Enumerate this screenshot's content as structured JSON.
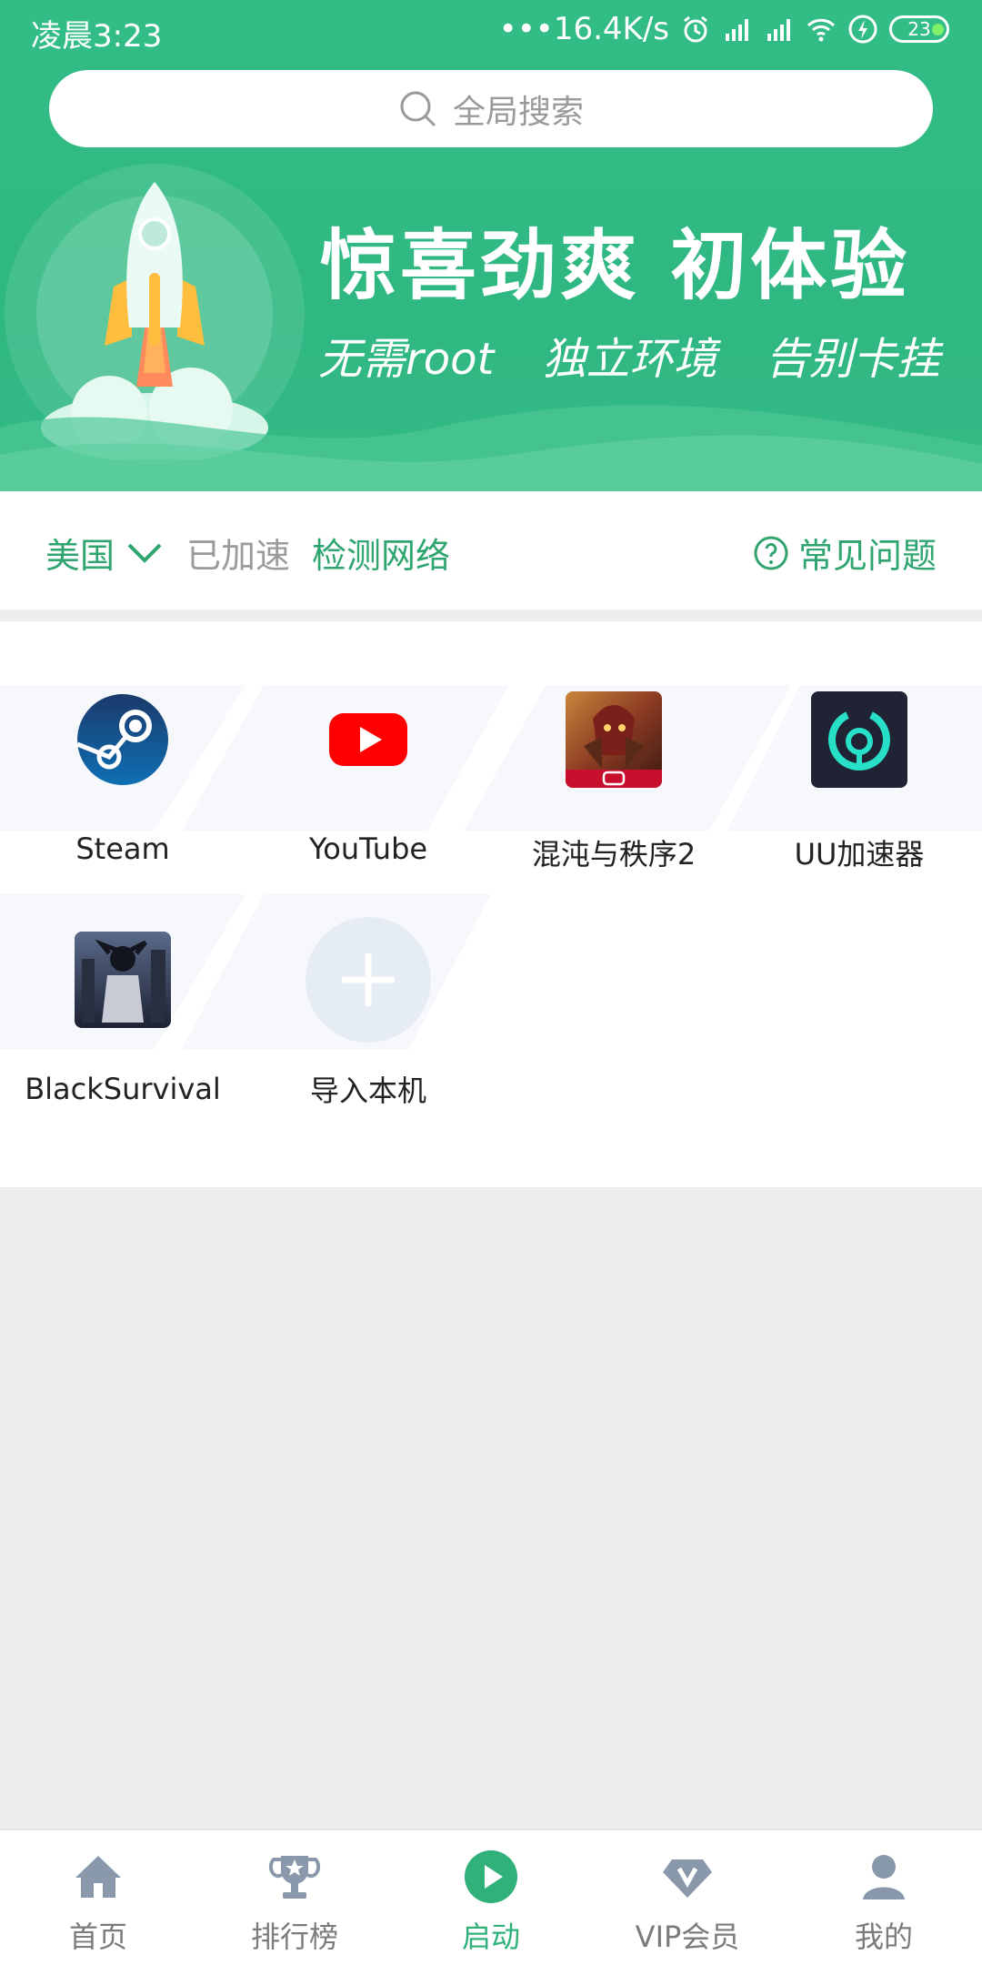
{
  "status_bar": {
    "time": "凌晨3:23",
    "speed": "•••16.4K/s",
    "battery": "23"
  },
  "search": {
    "placeholder": "全局搜索"
  },
  "banner": {
    "title": "惊喜劲爽  初体验",
    "subtitles": [
      "无需root",
      "独立环境",
      "告别卡挂"
    ]
  },
  "accel": {
    "region": "美国",
    "state": "已加速",
    "detect_link": "检测网络",
    "faq": "常见问题"
  },
  "apps": [
    {
      "label": "Steam",
      "icon": "steam-icon"
    },
    {
      "label": "YouTube",
      "icon": "youtube-icon"
    },
    {
      "label": "混沌与秩序2",
      "icon": "chaos-order-icon"
    },
    {
      "label": "UU加速器",
      "icon": "uu-accelerator-icon"
    },
    {
      "label": "BlackSurvival",
      "icon": "black-survival-icon"
    },
    {
      "label": "导入本机",
      "icon": "plus-icon"
    }
  ],
  "nav": [
    {
      "label": "首页",
      "icon": "home-icon"
    },
    {
      "label": "排行榜",
      "icon": "trophy-icon"
    },
    {
      "label": "启动",
      "icon": "play-icon",
      "active": true
    },
    {
      "label": "VIP会员",
      "icon": "diamond-icon"
    },
    {
      "label": "我的",
      "icon": "user-icon"
    }
  ],
  "colors": {
    "brand_green": "#2fb179",
    "banner_green": "#33bd86",
    "page_bg": "#ededed"
  }
}
